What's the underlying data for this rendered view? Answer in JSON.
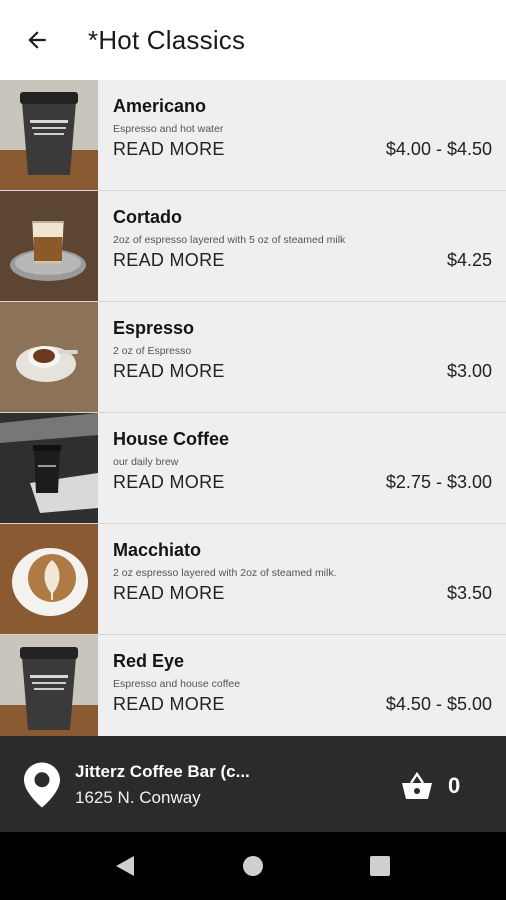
{
  "header": {
    "title": "*Hot Classics",
    "back_icon": "arrow-left-icon"
  },
  "items": [
    {
      "name": "Americano",
      "description": "Espresso and hot water",
      "more": "READ MORE",
      "price": "$4.00 - $4.50",
      "image": "coffee-cup-photo"
    },
    {
      "name": "Cortado",
      "description": "2oz of espresso layered with 5 oz of steamed milk",
      "more": "READ MORE",
      "price": "$4.25",
      "image": "cortado-glass-photo"
    },
    {
      "name": "Espresso",
      "description": "2 oz of Espresso",
      "more": "READ MORE",
      "price": "$3.00",
      "image": "espresso-cup-photo"
    },
    {
      "name": "House Coffee",
      "description": "our daily brew",
      "more": "READ MORE",
      "price": "$2.75 - $3.00",
      "image": "house-coffee-photo"
    },
    {
      "name": "Macchiato",
      "description": "2 oz espresso layered with 2oz of steamed milk.",
      "more": "READ MORE",
      "price": "$3.50",
      "image": "latte-art-photo"
    },
    {
      "name": "Red Eye",
      "description": "Espresso and house coffee",
      "more": "READ MORE",
      "price": "$4.50 - $5.00",
      "image": "coffee-cup-photo"
    }
  ],
  "store": {
    "name": "Jitterz Coffee Bar (c...",
    "address": "1625 N. Conway",
    "pin_icon": "location-pin-icon"
  },
  "cart": {
    "count": "0",
    "icon": "basket-icon"
  },
  "nav": {
    "back_icon": "nav-back-icon",
    "home_icon": "nav-home-icon",
    "recent_icon": "nav-recents-icon"
  }
}
